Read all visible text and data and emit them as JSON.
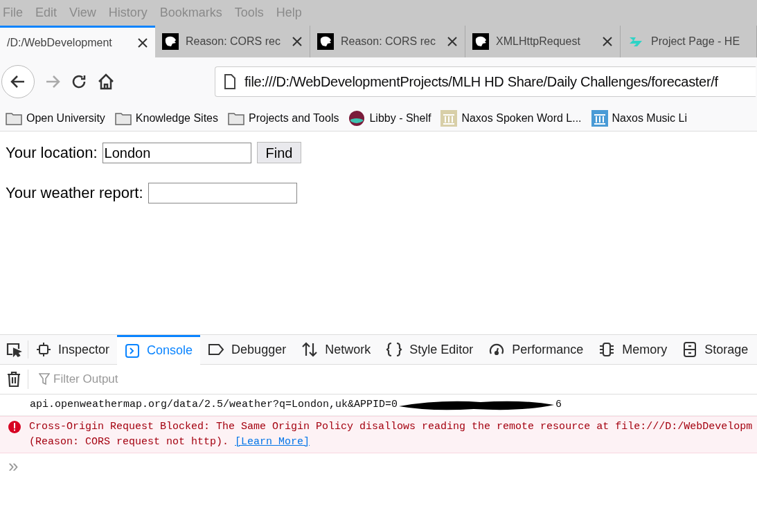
{
  "menu_bar": [
    "File",
    "Edit",
    "View",
    "History",
    "Bookmarks",
    "Tools",
    "Help"
  ],
  "tabs": [
    {
      "title": "/D:/WebDevelopment",
      "selected": true,
      "kind": "page"
    },
    {
      "title": "Reason: CORS rec",
      "selected": false,
      "kind": "mdn"
    },
    {
      "title": "Reason: CORS rec",
      "selected": false,
      "kind": "mdn"
    },
    {
      "title": "XMLHttpRequest",
      "selected": false,
      "kind": "mdn"
    },
    {
      "title": "Project Page - HE",
      "selected": false,
      "kind": "project"
    }
  ],
  "address_bar": {
    "url": "file:///D:/WebDevelopmentProjects/MLH HD Share/Daily Challenges/forecaster/f"
  },
  "bookmarks": [
    {
      "label": "Open University",
      "kind": "folder"
    },
    {
      "label": "Knowledge Sites",
      "kind": "folder"
    },
    {
      "label": "Projects and Tools",
      "kind": "folder"
    },
    {
      "label": "Libby - Shelf",
      "kind": "libby"
    },
    {
      "label": "Naxos Spoken Word L...",
      "kind": "naxos-beige"
    },
    {
      "label": "Naxos Music Li",
      "kind": "naxos-blue"
    }
  ],
  "page": {
    "location_label": "Your location:",
    "location_value": "London",
    "find_button": "Find",
    "report_label": "Your weather report:"
  },
  "devtools": {
    "tabs": [
      {
        "label": "Inspector",
        "selected": false,
        "kind": "inspector"
      },
      {
        "label": "Console",
        "selected": true,
        "kind": "console"
      },
      {
        "label": "Debugger",
        "selected": false,
        "kind": "debugger"
      },
      {
        "label": "Network",
        "selected": false,
        "kind": "network"
      },
      {
        "label": "Style Editor",
        "selected": false,
        "kind": "style"
      },
      {
        "label": "Performance",
        "selected": false,
        "kind": "performance"
      },
      {
        "label": "Memory",
        "selected": false,
        "kind": "memory"
      },
      {
        "label": "Storage",
        "selected": false,
        "kind": "storage"
      }
    ],
    "filter_placeholder": "Filter Output",
    "messages": [
      {
        "kind": "log",
        "text": "api.openweathermap.org/data/2.5/weather?q=London,uk&APPID=0",
        "text_after": "6"
      },
      {
        "kind": "error",
        "text": "Cross-Origin Request Blocked: The Same Origin Policy disallows reading the remote resource at file:///D:/WebDevelopm",
        "text_2": "(Reason: CORS request not http).",
        "link": "[Learn More]"
      }
    ],
    "prompt": "»"
  }
}
